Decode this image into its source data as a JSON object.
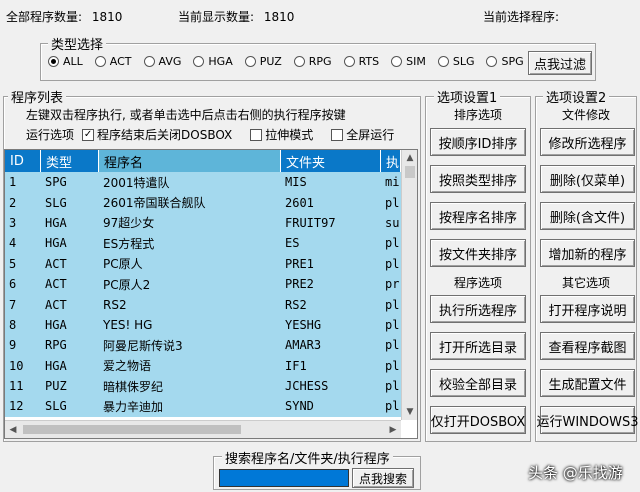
{
  "status": {
    "total_label": "全部程序数量:",
    "total_value": "1810",
    "shown_label": "当前显示数量:",
    "shown_value": "1810",
    "selected_label": "当前选择程序:"
  },
  "type_filter": {
    "title": "类型选择",
    "options": [
      "ALL",
      "ACT",
      "AVG",
      "HGA",
      "PUZ",
      "RPG",
      "RTS",
      "SIM",
      "SLG",
      "SPG"
    ],
    "selected": "ALL",
    "filter_button": "点我过滤"
  },
  "program_list": {
    "title": "程序列表",
    "hint": "左键双击程序执行, 或者单击选中后点击右侧的执行程序按键",
    "run_options_label": "运行选项",
    "checkboxes": [
      {
        "label": "程序结束后关闭DOSBOX",
        "checked": true
      },
      {
        "label": "拉伸模式",
        "checked": false
      },
      {
        "label": "全屏运行",
        "checked": false
      }
    ],
    "columns": [
      "ID",
      "类型",
      "程序名",
      "文件夹",
      "执"
    ],
    "rows": [
      [
        "1",
        "SPG",
        "2001特遣队",
        "MIS",
        "mi"
      ],
      [
        "2",
        "SLG",
        "2601帝国联合舰队",
        "2601",
        "pl"
      ],
      [
        "3",
        "HGA",
        "97超少女",
        "FRUIT97",
        "su"
      ],
      [
        "4",
        "HGA",
        "ES方程式",
        "ES",
        "pl"
      ],
      [
        "5",
        "ACT",
        "PC原人",
        "PRE1",
        "pl"
      ],
      [
        "6",
        "ACT",
        "PC原人2",
        "PRE2",
        "pr"
      ],
      [
        "7",
        "ACT",
        "RS2",
        "RS2",
        "pl"
      ],
      [
        "8",
        "HGA",
        "YES! HG",
        "YESHG",
        "pl"
      ],
      [
        "9",
        "RPG",
        "阿曼尼斯传说3",
        "AMAR3",
        "pl"
      ],
      [
        "10",
        "HGA",
        "爱之物语",
        "IF1",
        "pl"
      ],
      [
        "11",
        "PUZ",
        "暗棋侏罗纪",
        "JCHESS",
        "pl"
      ],
      [
        "12",
        "SLG",
        "暴力辛迪加",
        "SYND",
        "pl"
      ]
    ]
  },
  "options1": {
    "title": "选项设置1",
    "sort_heading": "排序选项",
    "sort_buttons": [
      "按顺序ID排序",
      "按照类型排序",
      "按程序名排序",
      "按文件夹排序"
    ],
    "program_heading": "程序选项",
    "program_buttons": [
      "执行所选程序",
      "打开所选目录",
      "校验全部目录",
      "仅打开DOSBOX"
    ]
  },
  "options2": {
    "title": "选项设置2",
    "file_heading": "文件修改",
    "file_buttons": [
      "修改所选程序",
      "删除(仅菜单)",
      "删除(含文件)",
      "增加新的程序"
    ],
    "other_heading": "其它选项",
    "other_buttons": [
      "打开程序说明",
      "查看程序截图",
      "生成配置文件",
      "运行WINDOWS3"
    ]
  },
  "search": {
    "title": "搜索程序名/文件夹/执行程序",
    "value": "",
    "button": "点我搜索"
  },
  "watermark": "头条 @乐找游"
}
